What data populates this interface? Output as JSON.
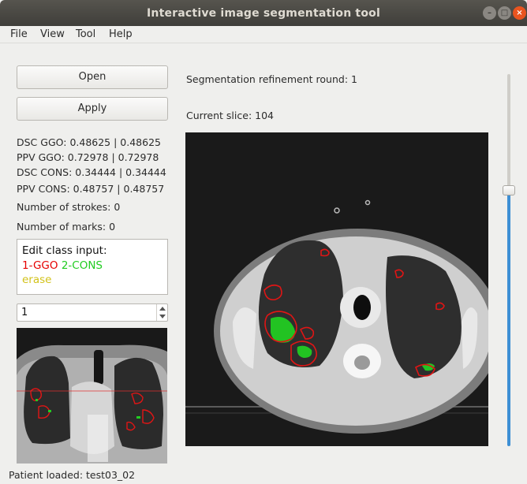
{
  "window": {
    "title": "Interactive image segmentation tool",
    "controls": {
      "minimize": "–",
      "maximize": "□",
      "close": "×"
    }
  },
  "menu": [
    "File",
    "View",
    "Tool",
    "Help"
  ],
  "buttons": {
    "open": "Open",
    "apply": "Apply"
  },
  "metrics": [
    "DSC GGO: 0.48625 | 0.48625",
    "PPV GGO: 0.72978 | 0.72978",
    "DSC CONS: 0.34444 | 0.34444",
    "PPV CONS: 0.48757 | 0.48757",
    "Number of strokes: 0",
    "Number of marks: 0"
  ],
  "class_input": {
    "header": "Edit class input:",
    "class1": "1-GGO",
    "class2": "2-CONS",
    "erase": "erase",
    "colors": {
      "ggo": "#e60000",
      "cons": "#22cc22",
      "erase": "#d2c21a"
    }
  },
  "spinbox": {
    "value": "1"
  },
  "refinement": "Segmentation refinement round: 1",
  "slice": "Current slice: 104",
  "slider": {
    "level": 0.68
  },
  "status": "Patient loaded: test03_02"
}
